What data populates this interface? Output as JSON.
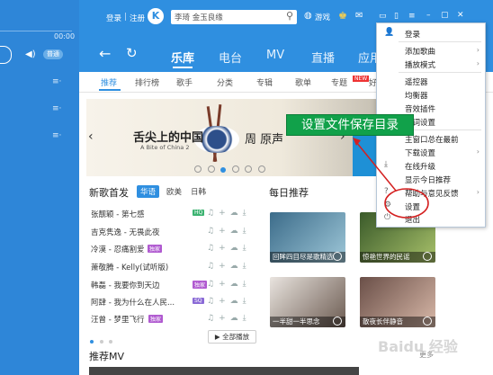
{
  "player": {
    "time": "00:00",
    "quality_label": "普通"
  },
  "top": {
    "login_label": "登录",
    "divider": "|",
    "register_label": "注册",
    "logo_letter": "K",
    "search_value": "李琦 金玉良缘",
    "game_label": "游戏"
  },
  "nav": {
    "tabs": [
      "乐库",
      "电台",
      "MV",
      "直播",
      "应用"
    ],
    "active": "乐库"
  },
  "subnav": {
    "tabs": [
      "推荐",
      "排行榜",
      "歌手",
      "分类",
      "专辑",
      "歌单",
      "专题",
      "好"
    ]
  },
  "banner": {
    "title_cn": "舌尖上的中国",
    "title_en": "A Bite of China 2",
    "extra": "周 原声"
  },
  "new_songs": {
    "title": "新歌首发",
    "filters": [
      "华语",
      "欧美",
      "日韩"
    ],
    "active_filter": "华语",
    "songs": [
      {
        "title": "张靓颖 - 第七感",
        "badge": "HQ"
      },
      {
        "title": "吉克隽逸 - 无畏此夜",
        "badge": ""
      },
      {
        "title": "冷漠 - 忍痛割爱",
        "badge": "独家"
      },
      {
        "title": "萧敬腾 - Kelly(试听版)",
        "badge": ""
      },
      {
        "title": "韩磊 - 我要你到天边",
        "badge": "独家"
      },
      {
        "title": "阿肆 - 我为什么在人民...",
        "badge": "SQ"
      },
      {
        "title": "汪曾 - 梦里飞行",
        "badge": "独家"
      }
    ],
    "play_all_label": "全部播放"
  },
  "daily": {
    "title": "每日推荐",
    "cards": [
      {
        "caption": "回眸四目尽是歌精选"
      },
      {
        "caption": "惊艳世界的民谣"
      },
      {
        "caption": "一半甜一半思念"
      },
      {
        "caption": "散夜长伴静音"
      }
    ],
    "more_label": "更多"
  },
  "mv_title": "推荐MV",
  "menu": {
    "items": [
      {
        "label": "登录",
        "icon": "user-icon",
        "arrow": false
      },
      {
        "label": "添加歌曲",
        "icon": "",
        "arrow": true
      },
      {
        "label": "播放模式",
        "icon": "",
        "arrow": true
      },
      {
        "label": "遥控器",
        "icon": "",
        "arrow": false
      },
      {
        "label": "均衡器",
        "icon": "",
        "arrow": false
      },
      {
        "label": "音效插件",
        "icon": "",
        "arrow": false
      },
      {
        "label": "歌词设置",
        "icon": "",
        "arrow": false
      },
      {
        "label": "主窗口总在最前",
        "icon": "",
        "arrow": false
      },
      {
        "label": "下载设置",
        "icon": "",
        "arrow": true
      },
      {
        "label": "在线升级",
        "icon": "download-icon",
        "arrow": false
      },
      {
        "label": "显示今日推荐",
        "icon": "",
        "arrow": false
      },
      {
        "label": "帮助与意见反馈",
        "icon": "help-icon",
        "arrow": true
      },
      {
        "label": "设置",
        "icon": "gear-icon",
        "arrow": false
      },
      {
        "label": "退出",
        "icon": "power-icon",
        "arrow": false
      }
    ]
  },
  "callout": {
    "text": "设置文件保存目录"
  },
  "watermark": "Baidu 经验"
}
